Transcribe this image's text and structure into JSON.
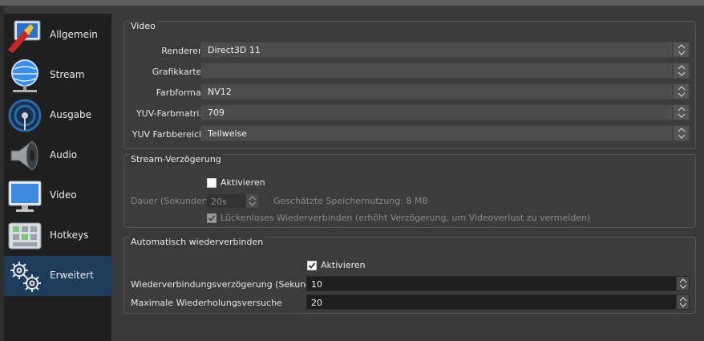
{
  "sidebar": {
    "items": [
      {
        "label": "Allgemein",
        "icon": "settings-general-icon",
        "active": false
      },
      {
        "label": "Stream",
        "icon": "stream-globe-icon",
        "active": false
      },
      {
        "label": "Ausgabe",
        "icon": "output-broadcast-icon",
        "active": false
      },
      {
        "label": "Audio",
        "icon": "speaker-icon",
        "active": false
      },
      {
        "label": "Video",
        "icon": "monitor-icon",
        "active": false
      },
      {
        "label": "Hotkeys",
        "icon": "keyboard-icon",
        "active": false
      },
      {
        "label": "Erweitert",
        "icon": "gears-icon",
        "active": true
      }
    ]
  },
  "video": {
    "title": "Video",
    "renderer_label": "Renderer:",
    "renderer_value": "Direct3D 11",
    "grafikkarte_label": "Grafikkarte:",
    "grafikkarte_value": "",
    "farbformat_label": "Farbformat",
    "farbformat_value": "NV12",
    "matrix_label": "YUV-Farbmatrix",
    "matrix_value": "709",
    "bereich_label": "YUV Farbbereich",
    "bereich_value": "Teilweise"
  },
  "delay": {
    "title": "Stream-Verzögerung",
    "enable_label": "Aktivieren",
    "enabled": false,
    "duration_label": "Dauer (Sekunden)",
    "duration_value": "20s",
    "memory_text": "Geschätzte Speichernutzung: 8 MB",
    "reconnect_label": "Lückenloses Wiederverbinden (erhöht Verzögerung, um Videoverlust zu vermeiden)",
    "reconnect_checked": true
  },
  "autoreconnect": {
    "title": "Automatisch wiederverbinden",
    "enable_label": "Aktivieren",
    "enabled": true,
    "delay_label": "Wiederverbindungsverzögerung (Sekunden)",
    "delay_value": "10",
    "retries_label": "Maximale Wiederholungsversuche",
    "retries_value": "20"
  },
  "colors": {
    "active_item": "#1d3c5c",
    "sidebar_bg": "#1f1f1f",
    "panel_bg": "#3a3a3a"
  }
}
